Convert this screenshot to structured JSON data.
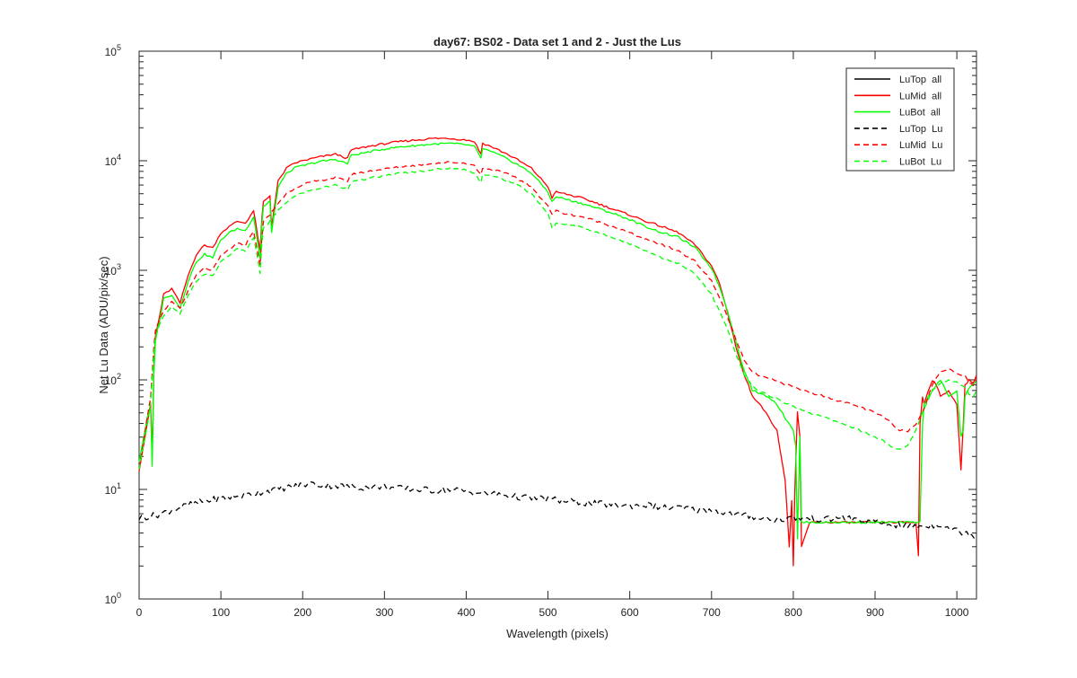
{
  "chart_data": {
    "type": "line",
    "title": "day67: BS02 - Data set 1 and 2 - Just the Lus",
    "xlabel": "Wavelength (pixels)",
    "ylabel": "Net Lu Data (ADU/pix/sec)",
    "xlim": [
      0,
      1024
    ],
    "ylim": [
      1,
      100000
    ],
    "yscale": "log",
    "xticks": [
      "0",
      "100",
      "200",
      "300",
      "400",
      "500",
      "600",
      "700",
      "800",
      "900",
      "1000"
    ],
    "ytick_bases": [
      "10",
      "10",
      "10",
      "10",
      "10",
      "10"
    ],
    "ytick_exponents": [
      "0",
      "1",
      "2",
      "3",
      "4",
      "5"
    ],
    "grid": false,
    "legend_position": "top-right",
    "series": [
      {
        "name": "LuTop  all",
        "color": "#000000",
        "style": "solid",
        "x": [
          0,
          1024
        ],
        "y": [
          null,
          null
        ]
      },
      {
        "name": "LuMid  all",
        "color": "#ff0000",
        "style": "solid",
        "x": [
          0,
          10,
          14,
          16,
          18,
          20,
          25,
          30,
          40,
          50,
          60,
          70,
          80,
          90,
          100,
          110,
          120,
          130,
          140,
          148,
          150,
          152,
          160,
          162,
          170,
          180,
          190,
          200,
          220,
          240,
          255,
          258,
          260,
          280,
          300,
          320,
          340,
          360,
          380,
          400,
          410,
          418,
          420,
          430,
          440,
          450,
          460,
          480,
          500,
          505,
          510,
          520,
          540,
          560,
          580,
          600,
          620,
          640,
          660,
          680,
          700,
          710,
          720,
          730,
          740,
          745,
          750,
          760,
          770,
          780,
          790,
          795,
          798,
          800,
          802,
          805,
          808,
          810,
          820,
          840,
          860,
          880,
          900,
          920,
          940,
          950,
          953,
          955,
          958,
          960,
          965,
          970,
          975,
          980,
          990,
          1000,
          1005,
          1008,
          1010,
          1015,
          1020,
          1024
        ],
        "y": [
          15,
          40,
          60,
          20,
          120,
          250,
          380,
          600,
          680,
          500,
          900,
          1400,
          1700,
          1600,
          2200,
          2500,
          2800,
          2700,
          3500,
          1500,
          2900,
          4200,
          4800,
          2500,
          6500,
          8500,
          9500,
          10000,
          10800,
          11500,
          10500,
          12000,
          12600,
          13500,
          14300,
          15000,
          15500,
          16000,
          16000,
          15500,
          15000,
          11500,
          14500,
          13500,
          12500,
          11500,
          10500,
          8500,
          5800,
          4600,
          5200,
          5000,
          4600,
          4100,
          3600,
          3200,
          2800,
          2500,
          2200,
          1700,
          1100,
          750,
          400,
          200,
          110,
          90,
          70,
          60,
          45,
          35,
          12,
          3,
          8,
          2,
          10,
          50,
          30,
          3,
          5,
          5,
          5,
          5,
          5,
          5,
          5,
          5,
          2.5,
          40,
          70,
          60,
          80,
          100,
          90,
          70,
          80,
          60,
          15,
          40,
          90,
          100,
          95,
          110
        ]
      },
      {
        "name": "LuBot  all",
        "color": "#00ff00",
        "style": "solid",
        "x": [
          0,
          10,
          14,
          16,
          18,
          20,
          25,
          30,
          40,
          50,
          60,
          70,
          80,
          90,
          100,
          110,
          120,
          130,
          140,
          148,
          150,
          152,
          160,
          162,
          170,
          180,
          190,
          200,
          220,
          240,
          255,
          258,
          260,
          280,
          300,
          320,
          340,
          360,
          380,
          400,
          410,
          418,
          420,
          430,
          440,
          450,
          460,
          480,
          500,
          505,
          510,
          520,
          540,
          560,
          580,
          600,
          620,
          640,
          660,
          680,
          700,
          710,
          720,
          730,
          740,
          745,
          750,
          760,
          770,
          780,
          790,
          795,
          800,
          803,
          805,
          808,
          810,
          820,
          840,
          860,
          880,
          900,
          920,
          940,
          950,
          953,
          955,
          958,
          960,
          965,
          970,
          975,
          980,
          990,
          1000,
          1005,
          1008,
          1010,
          1015,
          1020,
          1024
        ],
        "y": [
          18,
          45,
          55,
          16,
          110,
          230,
          350,
          550,
          600,
          450,
          800,
          1200,
          1400,
          1300,
          1900,
          2200,
          2400,
          2300,
          3100,
          1300,
          2600,
          3800,
          4300,
          2200,
          5800,
          7600,
          8600,
          9000,
          9800,
          10300,
          9400,
          10800,
          11200,
          12000,
          12800,
          13400,
          13800,
          14200,
          14400,
          14000,
          13500,
          10500,
          13000,
          12100,
          11300,
          10400,
          9500,
          7700,
          5200,
          4200,
          4700,
          4500,
          4100,
          3700,
          3300,
          2900,
          2500,
          2200,
          2000,
          1600,
          1050,
          700,
          420,
          220,
          120,
          100,
          80,
          75,
          70,
          60,
          45,
          40,
          35,
          25,
          3.5,
          30,
          5,
          5,
          5,
          5,
          5,
          5,
          5,
          5,
          5,
          5,
          5,
          40,
          60,
          70,
          80,
          90,
          100,
          70,
          80,
          30,
          35,
          70,
          85,
          90,
          100
        ]
      },
      {
        "name": "LuTop  Lu",
        "color": "#000000",
        "style": "dashed",
        "x": [
          0,
          20,
          40,
          60,
          80,
          100,
          120,
          140,
          160,
          180,
          200,
          210,
          220,
          240,
          260,
          280,
          300,
          320,
          340,
          360,
          380,
          400,
          420,
          440,
          460,
          480,
          500,
          520,
          540,
          560,
          580,
          600,
          620,
          640,
          660,
          680,
          700,
          720,
          740,
          760,
          780,
          800,
          820,
          840,
          860,
          880,
          900,
          920,
          940,
          960,
          980,
          1000,
          1024
        ],
        "y": [
          5.5,
          5.8,
          6.5,
          7.2,
          7.8,
          8.3,
          8.6,
          9.2,
          9.8,
          10.4,
          11,
          11.3,
          11,
          10.8,
          10.6,
          10.4,
          10.6,
          10.2,
          10,
          9.8,
          10,
          9.6,
          9.2,
          9,
          8.6,
          8.3,
          8.2,
          7.8,
          7.6,
          7.4,
          7.2,
          7.1,
          7.2,
          6.8,
          6.8,
          6.5,
          6.5,
          6,
          5.8,
          5.5,
          5.3,
          5.5,
          5.4,
          5.3,
          5.6,
          5.2,
          5,
          4.8,
          4.6,
          4.6,
          4.8,
          4.2,
          3.8
        ]
      },
      {
        "name": "LuMid  Lu",
        "color": "#ff0000",
        "style": "dashed",
        "x": [
          0,
          10,
          14,
          18,
          20,
          25,
          30,
          40,
          50,
          60,
          70,
          80,
          90,
          100,
          110,
          120,
          130,
          140,
          148,
          150,
          152,
          160,
          170,
          180,
          190,
          200,
          220,
          240,
          255,
          258,
          260,
          280,
          300,
          320,
          340,
          360,
          380,
          400,
          410,
          418,
          420,
          440,
          460,
          480,
          500,
          505,
          510,
          520,
          540,
          560,
          580,
          600,
          620,
          640,
          660,
          680,
          700,
          710,
          720,
          730,
          740,
          750,
          760,
          780,
          800,
          820,
          840,
          860,
          880,
          900,
          910,
          920,
          930,
          940,
          950,
          960,
          970,
          980,
          990,
          1000,
          1010,
          1015,
          1020,
          1024
        ],
        "y": [
          16,
          45,
          70,
          200,
          280,
          350,
          420,
          520,
          450,
          650,
          900,
          1050,
          1000,
          1350,
          1550,
          1750,
          1700,
          2300,
          1100,
          2000,
          2800,
          3200,
          4100,
          5000,
          5600,
          6100,
          6600,
          7000,
          6500,
          7300,
          7500,
          8000,
          8400,
          8800,
          9100,
          9500,
          9700,
          9500,
          9000,
          7400,
          8600,
          8000,
          7100,
          5700,
          3900,
          3200,
          3500,
          3300,
          3100,
          2800,
          2500,
          2200,
          1900,
          1700,
          1500,
          1200,
          800,
          560,
          370,
          230,
          150,
          118,
          108,
          97,
          86,
          77,
          70,
          63,
          57,
          50,
          46,
          40,
          35,
          34,
          40,
          55,
          90,
          120,
          125,
          115,
          110,
          95,
          90,
          100
        ]
      },
      {
        "name": "LuBot  Lu",
        "color": "#00ff00",
        "style": "dashed",
        "x": [
          0,
          10,
          14,
          18,
          20,
          25,
          30,
          40,
          50,
          60,
          70,
          80,
          90,
          100,
          110,
          120,
          130,
          140,
          148,
          150,
          152,
          160,
          170,
          180,
          190,
          200,
          220,
          240,
          255,
          258,
          260,
          280,
          300,
          320,
          340,
          360,
          380,
          400,
          410,
          418,
          420,
          440,
          460,
          480,
          500,
          505,
          510,
          520,
          540,
          560,
          580,
          600,
          620,
          640,
          660,
          680,
          700,
          710,
          720,
          730,
          740,
          750,
          760,
          780,
          800,
          820,
          840,
          860,
          880,
          900,
          910,
          920,
          930,
          940,
          950,
          960,
          970,
          980,
          990,
          1000,
          1010,
          1015,
          1020,
          1024
        ],
        "y": [
          15,
          40,
          60,
          180,
          250,
          320,
          380,
          460,
          400,
          580,
          800,
          930,
          880,
          1200,
          1380,
          1550,
          1500,
          2000,
          950,
          1750,
          2400,
          2800,
          3500,
          4200,
          4700,
          5100,
          5600,
          6000,
          5500,
          6200,
          6400,
          6900,
          7300,
          7700,
          8000,
          8300,
          8500,
          8300,
          7800,
          6400,
          7500,
          7000,
          6200,
          5000,
          3300,
          2400,
          2700,
          2600,
          2500,
          2200,
          2000,
          1750,
          1500,
          1300,
          1150,
          920,
          600,
          420,
          280,
          170,
          110,
          88,
          78,
          67,
          57,
          50,
          45,
          40,
          35,
          30,
          28,
          24,
          23,
          25,
          35,
          55,
          80,
          95,
          100,
          95,
          85,
          75,
          70,
          80
        ]
      }
    ]
  }
}
